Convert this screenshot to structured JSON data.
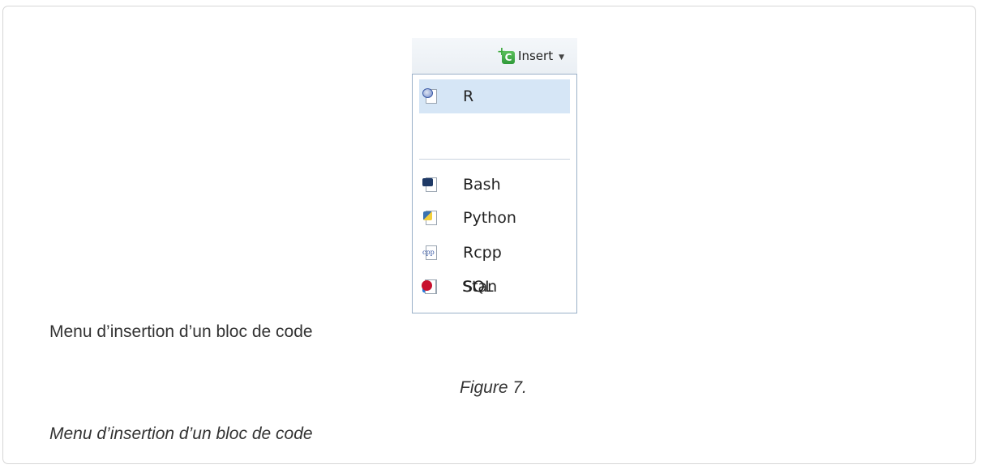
{
  "toolbar": {
    "insert_label": "Insert",
    "insert_icon": "insert-chunk-icon",
    "insert_icon_letter": "C",
    "dropdown_icon": "chevron-down-icon"
  },
  "menu": {
    "items": [
      {
        "label": "R",
        "icon": "r-icon",
        "selected": true
      },
      {
        "label": "Bash",
        "icon": "bash-icon"
      },
      {
        "label": "Python",
        "icon": "python-icon"
      },
      {
        "label": "Rcpp",
        "icon": "rcpp-icon",
        "icon_text": "cpp"
      },
      {
        "label": "SQL",
        "icon": "sql-icon"
      },
      {
        "label": "Stan",
        "icon": "stan-icon"
      }
    ]
  },
  "caption": {
    "image_alt_text": "Menu d’insertion d’un bloc de code",
    "figure_label": "Figure 7.",
    "figure_caption": "Menu d’insertion d’un bloc de code"
  },
  "colors": {
    "selected_bg": "#d6e6f6",
    "menu_border": "#9ab0c8",
    "chunk_green": "#2f9a3a"
  }
}
